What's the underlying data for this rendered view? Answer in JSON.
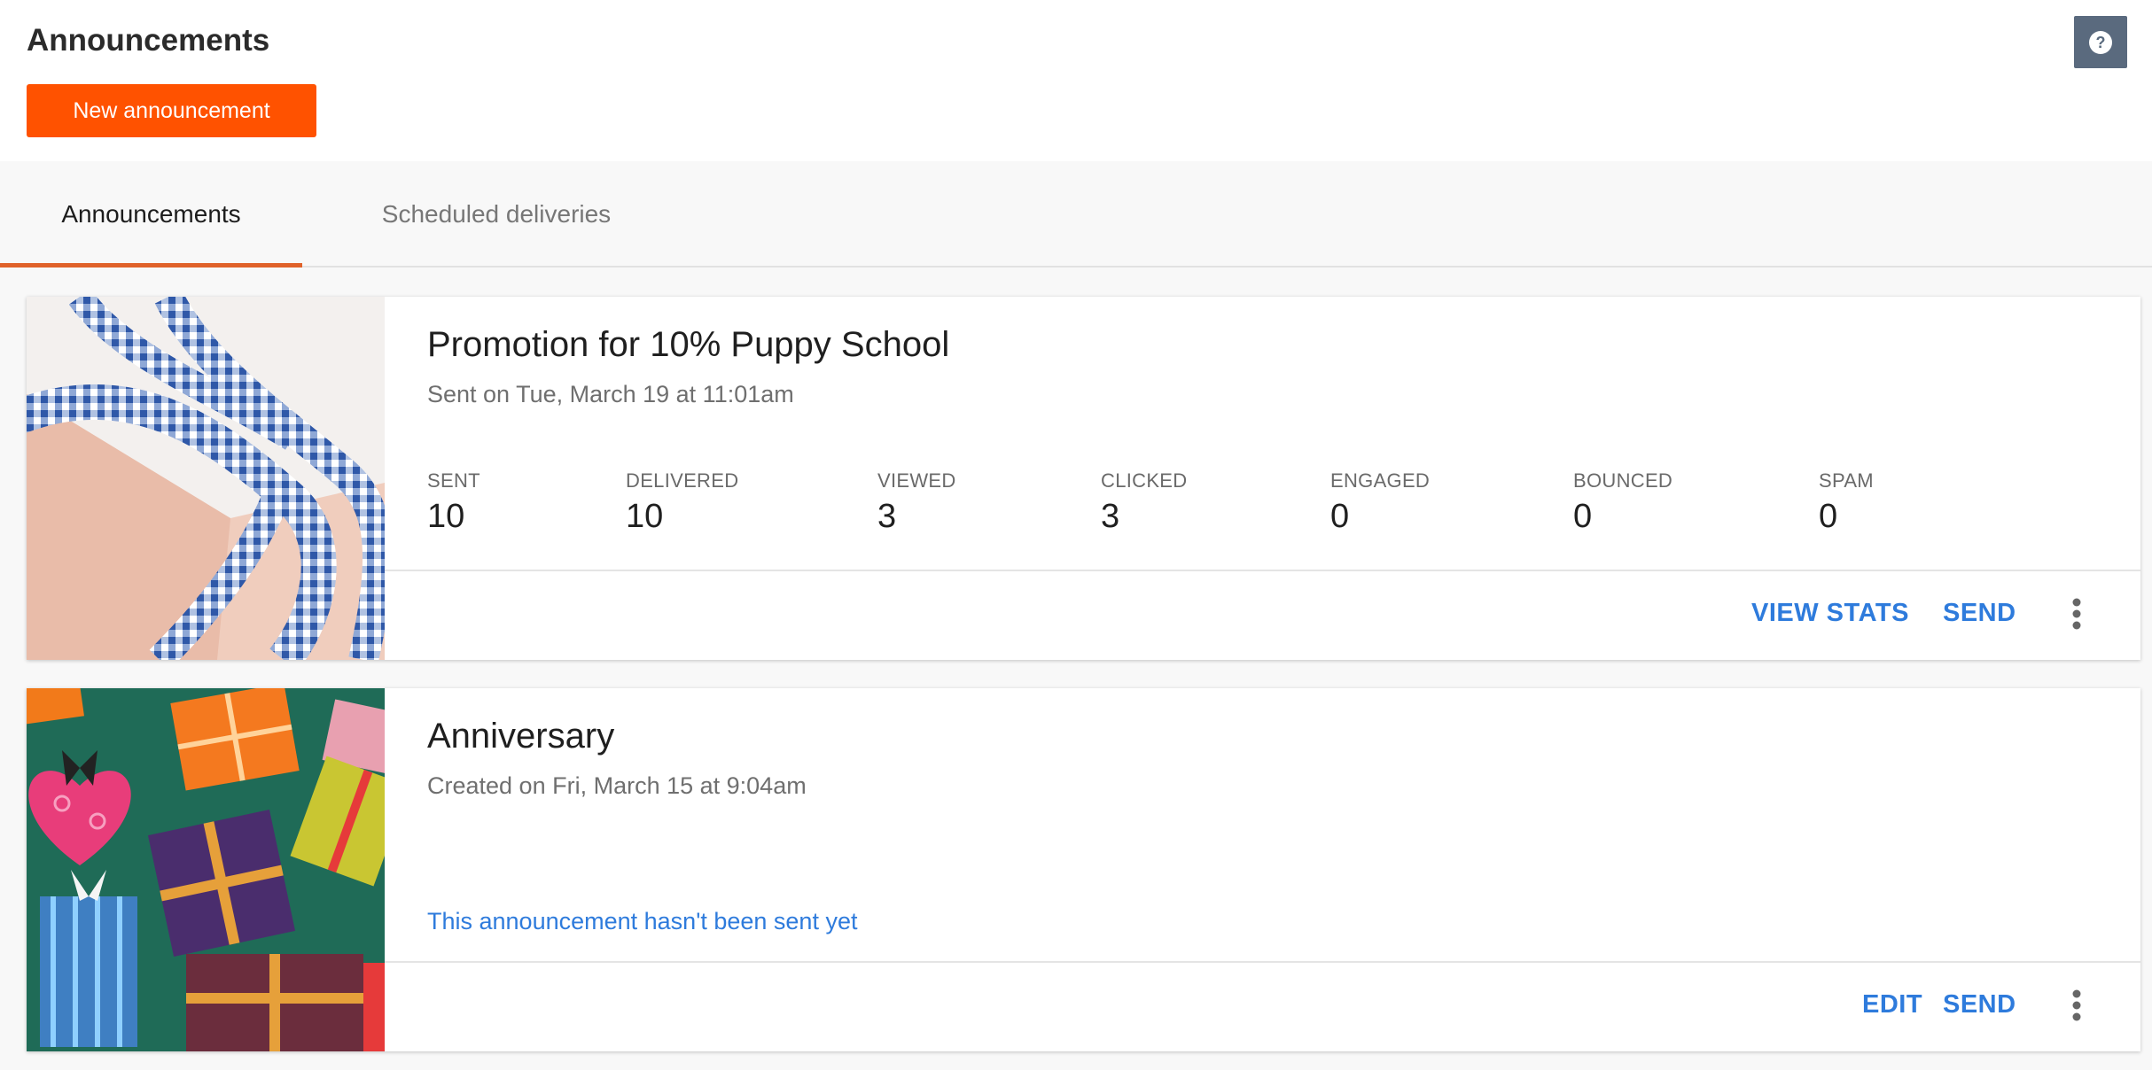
{
  "header": {
    "title": "Announcements",
    "new_button_label": "New announcement",
    "help_icon": "question-circle-icon"
  },
  "tabs": [
    {
      "label": "Announcements",
      "active": true
    },
    {
      "label": "Scheduled deliveries",
      "active": false
    }
  ],
  "colors": {
    "accent_orange": "#ff5200",
    "tab_underline": "#e0622a",
    "link_blue": "#2e7bdc",
    "help_button_bg": "#5a6a7e"
  },
  "announcements": [
    {
      "title": "Promotion for 10% Puppy School",
      "subtitle": "Sent on Tue, March 19 at 11:01am",
      "image": "gift-box-ribbon-photo",
      "stats": [
        {
          "label": "SENT",
          "value": "10"
        },
        {
          "label": "DELIVERED",
          "value": "10"
        },
        {
          "label": "VIEWED",
          "value": "3"
        },
        {
          "label": "CLICKED",
          "value": "3"
        },
        {
          "label": "ENGAGED",
          "value": "0"
        },
        {
          "label": "BOUNCED",
          "value": "0"
        },
        {
          "label": "SPAM",
          "value": "0"
        }
      ],
      "actions": [
        "VIEW STATS",
        "SEND"
      ]
    },
    {
      "title": "Anniversary",
      "subtitle": "Created on Fri, March 15 at 9:04am",
      "image": "gift-boxes-pattern",
      "status_message": "This announcement hasn't been sent yet",
      "actions": [
        "EDIT",
        "SEND"
      ]
    }
  ]
}
